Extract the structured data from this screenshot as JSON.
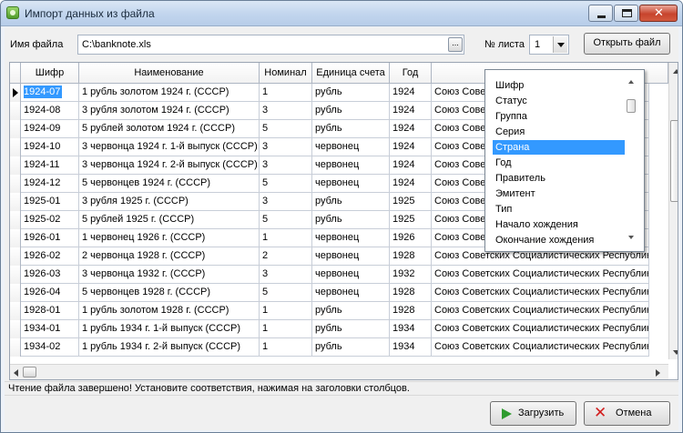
{
  "window": {
    "title": "Импорт данных из файла",
    "icon": "import-data-icon",
    "close_glyph": "✕"
  },
  "form": {
    "file_label": "Имя файла",
    "file_value": "C:\\banknote.xls",
    "browse_label": "...",
    "sheet_label": "№ листа",
    "sheet_value": "1",
    "open_button": "Открыть файл"
  },
  "table": {
    "headers": [
      "Шифр",
      "Наименование",
      "Номинал",
      "Единица счета",
      "Год",
      ""
    ],
    "selected_row": 0,
    "rows": [
      {
        "code": "1924-07",
        "name": "1 рубль золотом 1924 г. (СССР)",
        "nominal": "1",
        "unit": "рубль",
        "year": "1924",
        "country": "Союз Сове"
      },
      {
        "code": "1924-08",
        "name": "3 рубля золотом 1924 г. (СССР)",
        "nominal": "3",
        "unit": "рубль",
        "year": "1924",
        "country": "Союз Сове"
      },
      {
        "code": "1924-09",
        "name": "5 рублей золотом 1924 г. (СССР)",
        "nominal": "5",
        "unit": "рубль",
        "year": "1924",
        "country": "Союз Сове"
      },
      {
        "code": "1924-10",
        "name": "3 червонца 1924 г. 1-й выпуск (СССР)",
        "nominal": "3",
        "unit": "червонец",
        "year": "1924",
        "country": "Союз Сове"
      },
      {
        "code": "1924-11",
        "name": "3 червонца 1924 г. 2-й выпуск (СССР)",
        "nominal": "3",
        "unit": "червонец",
        "year": "1924",
        "country": "Союз Сове"
      },
      {
        "code": "1924-12",
        "name": "5 червонцев 1924 г. (СССР)",
        "nominal": "5",
        "unit": "червонец",
        "year": "1924",
        "country": "Союз Сове"
      },
      {
        "code": "1925-01",
        "name": "3 рубля 1925 г. (СССР)",
        "nominal": "3",
        "unit": "рубль",
        "year": "1925",
        "country": "Союз Сове"
      },
      {
        "code": "1925-02",
        "name": "5 рублей 1925 г. (СССР)",
        "nominal": "5",
        "unit": "рубль",
        "year": "1925",
        "country": "Союз Сове"
      },
      {
        "code": "1926-01",
        "name": "1 червонец 1926 г. (СССР)",
        "nominal": "1",
        "unit": "червонец",
        "year": "1926",
        "country": "Союз Сове"
      },
      {
        "code": "1926-02",
        "name": "2 червонца 1928 г. (СССР)",
        "nominal": "2",
        "unit": "червонец",
        "year": "1928",
        "country": "Союз Советских Социалистических Республик"
      },
      {
        "code": "1926-03",
        "name": "3 червонца 1932 г. (СССР)",
        "nominal": "3",
        "unit": "червонец",
        "year": "1932",
        "country": "Союз Советских Социалистических Республик"
      },
      {
        "code": "1926-04",
        "name": "5 червонцев 1928 г. (СССР)",
        "nominal": "5",
        "unit": "червонец",
        "year": "1928",
        "country": "Союз Советских Социалистических Республик"
      },
      {
        "code": "1928-01",
        "name": "1 рубль золотом 1928 г. (СССР)",
        "nominal": "1",
        "unit": "рубль",
        "year": "1928",
        "country": "Союз Советских Социалистических Республик"
      },
      {
        "code": "1934-01",
        "name": "1 рубль 1934 г. 1-й выпуск (СССР)",
        "nominal": "1",
        "unit": "рубль",
        "year": "1934",
        "country": "Союз Советских Социалистических Республик"
      },
      {
        "code": "1934-02",
        "name": "1 рубль 1934 г. 2-й выпуск (СССР)",
        "nominal": "1",
        "unit": "рубль",
        "year": "1934",
        "country": "Союз Советских Социалистических Республик"
      }
    ]
  },
  "popup": {
    "items": [
      "Шифр",
      "Статус",
      "Группа",
      "Серия",
      "Страна",
      "Год",
      "Правитель",
      "Эмитент",
      "Тип",
      "Начало хождения",
      "Окончание хождения"
    ],
    "selected_index": 4
  },
  "status": {
    "message": "Чтение файла завершено! Установите соответствия, нажимая на заголовки столбцов."
  },
  "buttons": {
    "load": "Загрузить",
    "cancel": "Отмена"
  },
  "colors": {
    "selection": "#3399ff",
    "window_frame": "#6a7f98",
    "status_bg": "#f0f0f0"
  }
}
